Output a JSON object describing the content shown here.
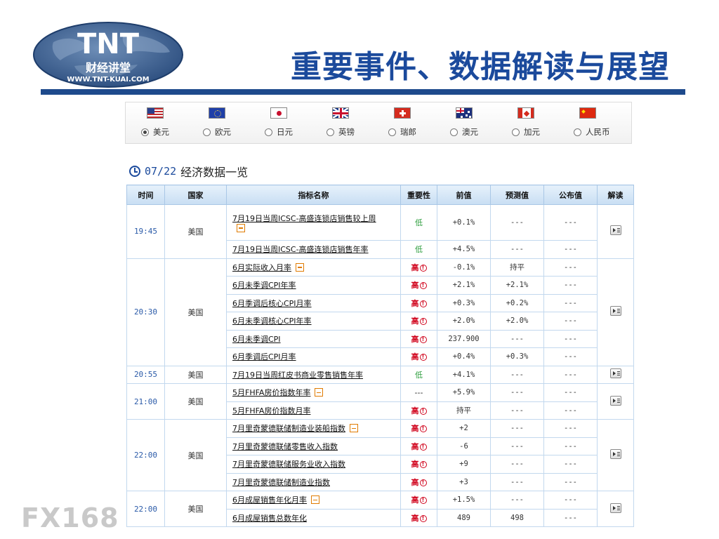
{
  "logo": {
    "text": "TNT",
    "subtitle": "财经讲堂",
    "url": "WWW.TNT-KUAI.COM"
  },
  "page_title": "重要事件、数据解读与展望",
  "colors": {
    "title": "#1b4a9c",
    "rule": "#1e4a8c",
    "high": "#d0021b",
    "low": "#2e9e3e",
    "header_bg": "#c8def3"
  },
  "currencies": [
    {
      "label": "美元",
      "flag": "us-flag-icon",
      "checked": true
    },
    {
      "label": "欧元",
      "flag": "eu-flag-icon",
      "checked": false
    },
    {
      "label": "日元",
      "flag": "jp-flag-icon",
      "checked": false
    },
    {
      "label": "英镑",
      "flag": "gb-flag-icon",
      "checked": false
    },
    {
      "label": "瑞郎",
      "flag": "ch-flag-icon",
      "checked": false
    },
    {
      "label": "澳元",
      "flag": "au-flag-icon",
      "checked": false
    },
    {
      "label": "加元",
      "flag": "ca-flag-icon",
      "checked": false
    },
    {
      "label": "人民币",
      "flag": "cn-flag-icon",
      "checked": false
    }
  ],
  "section": {
    "date": "07/22",
    "title": "经济数据一览"
  },
  "table": {
    "headers": [
      "时间",
      "国家",
      "指标名称",
      "重要性",
      "前值",
      "预测值",
      "公布值",
      "解读"
    ],
    "groups": [
      {
        "time": "19:45",
        "country": "美国",
        "rows": [
          {
            "name": "7月19日当周ICSC-高盛连锁店销售较上周",
            "expandable": true,
            "importance": "低",
            "level": "low",
            "prev": "+0.1%",
            "forecast": "---",
            "actual": "---",
            "wrap": true
          },
          {
            "name": "7月19日当周ICSC-高盛连锁店销售年率",
            "expandable": false,
            "importance": "低",
            "level": "low",
            "prev": "+4.5%",
            "forecast": "---",
            "actual": "---"
          }
        ]
      },
      {
        "time": "20:30",
        "country": "美国",
        "rows": [
          {
            "name": "6月实际收入月率",
            "expandable": true,
            "importance": "高",
            "level": "high",
            "prev": "-0.1%",
            "forecast": "持平",
            "actual": "---"
          },
          {
            "name": "6月未季调CPI年率",
            "expandable": false,
            "importance": "高",
            "level": "high",
            "prev": "+2.1%",
            "forecast": "+2.1%",
            "actual": "---"
          },
          {
            "name": "6月季调后核心CPI月率",
            "expandable": false,
            "importance": "高",
            "level": "high",
            "prev": "+0.3%",
            "forecast": "+0.2%",
            "actual": "---"
          },
          {
            "name": "6月未季调核心CPI年率",
            "expandable": false,
            "importance": "高",
            "level": "high",
            "prev": "+2.0%",
            "forecast": "+2.0%",
            "actual": "---"
          },
          {
            "name": "6月未季调CPI",
            "expandable": false,
            "importance": "高",
            "level": "high",
            "prev": "237.900",
            "forecast": "---",
            "actual": "---"
          },
          {
            "name": "6月季调后CPI月率",
            "expandable": false,
            "importance": "高",
            "level": "high",
            "prev": "+0.4%",
            "forecast": "+0.3%",
            "actual": "---"
          }
        ]
      },
      {
        "time": "20:55",
        "country": "美国",
        "rows": [
          {
            "name": "7月19日当周红皮书商业零售销售年率",
            "expandable": false,
            "importance": "低",
            "level": "low",
            "prev": "+4.1%",
            "forecast": "---",
            "actual": "---"
          }
        ]
      },
      {
        "time": "21:00",
        "country": "美国",
        "rows": [
          {
            "name": "5月FHFA房价指数年率",
            "expandable": true,
            "importance": "---",
            "level": "none",
            "prev": "+5.9%",
            "forecast": "---",
            "actual": "---"
          },
          {
            "name": "5月FHFA房价指数月率",
            "expandable": false,
            "importance": "高",
            "level": "high",
            "prev": "持平",
            "forecast": "---",
            "actual": "---"
          }
        ]
      },
      {
        "time": "22:00",
        "country": "美国",
        "rows": [
          {
            "name": "7月里奇蒙德联储制造业装船指数",
            "expandable": true,
            "importance": "高",
            "level": "high",
            "prev": "+2",
            "forecast": "---",
            "actual": "---"
          },
          {
            "name": "7月里奇蒙德联储零售收入指数",
            "expandable": false,
            "importance": "高",
            "level": "high",
            "prev": "-6",
            "forecast": "---",
            "actual": "---"
          },
          {
            "name": "7月里奇蒙德联储服务业收入指数",
            "expandable": false,
            "importance": "高",
            "level": "high",
            "prev": "+9",
            "forecast": "---",
            "actual": "---"
          },
          {
            "name": "7月里奇蒙德联储制造业指数",
            "expandable": false,
            "importance": "高",
            "level": "high",
            "prev": "+3",
            "forecast": "---",
            "actual": "---"
          }
        ]
      },
      {
        "time": "22:00",
        "country": "美国",
        "rows": [
          {
            "name": "6月成屋销售年化月率",
            "expandable": true,
            "importance": "高",
            "level": "high",
            "prev": "+1.5%",
            "forecast": "---",
            "actual": "---"
          },
          {
            "name": "6月成屋销售总数年化",
            "expandable": false,
            "importance": "高",
            "level": "high",
            "prev": "489",
            "forecast": "498",
            "actual": "---"
          }
        ]
      }
    ]
  },
  "watermark": "FX168"
}
